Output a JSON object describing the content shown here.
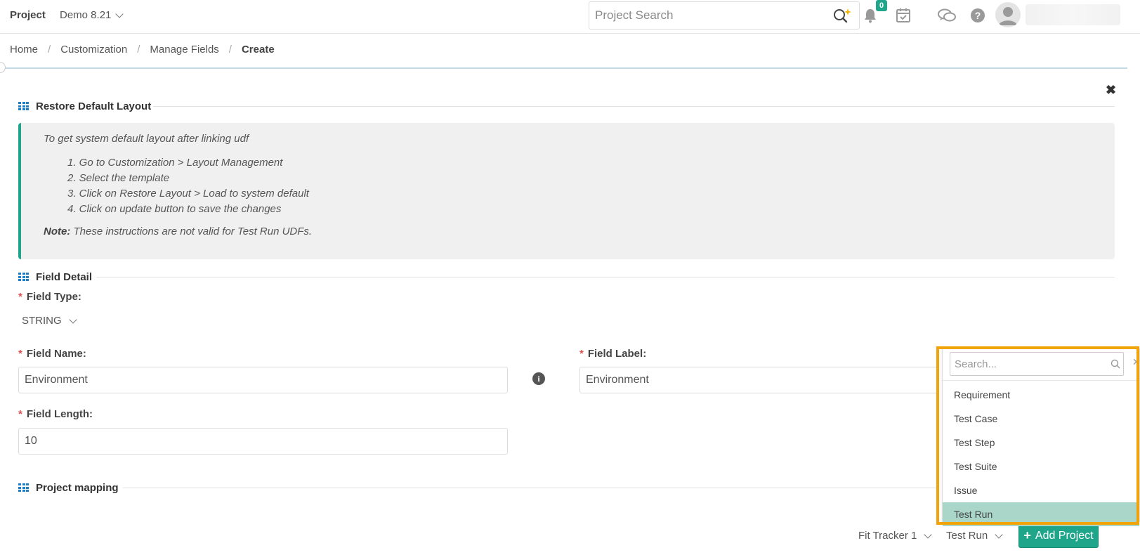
{
  "header": {
    "brand": "Project",
    "project_name": "Demo 8.21",
    "search_placeholder": "Project Search",
    "notification_count": "0"
  },
  "breadcrumb": {
    "items": [
      "Home",
      "Customization",
      "Manage Fields"
    ],
    "current": "Create",
    "separator": "/"
  },
  "restore_section": {
    "title": "Restore Default Layout",
    "intro": "To get system default layout after linking udf",
    "steps": [
      "1. Go to Customization > Layout Management",
      "2. Select the template",
      "3. Click on Restore Layout > Load to system default",
      "4. Click on update button to save the changes"
    ],
    "note_label": "Note:",
    "note_text": "These instructions are not valid for Test Run UDFs."
  },
  "field_detail": {
    "title": "Field Detail",
    "field_type_label": "Field Type:",
    "field_type_value": "STRING",
    "field_name_label": "Field Name:",
    "field_name_value": "Environment",
    "field_label_label": "Field Label:",
    "field_label_value": "Environment",
    "field_length_label": "Field Length:",
    "field_length_value": "10",
    "required_marker": "*"
  },
  "project_mapping": {
    "title": "Project mapping",
    "project_select": "Fit Tracker 1",
    "entity_select": "Test Run",
    "add_button": "Add Project"
  },
  "dropdown": {
    "search_placeholder": "Search...",
    "options": [
      "Requirement",
      "Test Case",
      "Test Step",
      "Test Suite",
      "Issue",
      "Test Run"
    ],
    "selected": "Test Run"
  },
  "colors": {
    "accent": "#1fa58a",
    "highlight_border": "#f0a30a",
    "selected_option": "#a9d6c9",
    "section_icon": "#1f7ec4",
    "required": "#d9534f"
  }
}
